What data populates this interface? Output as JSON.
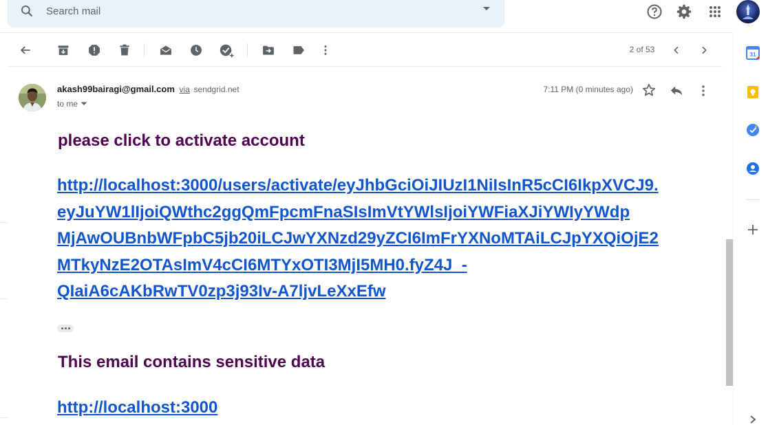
{
  "search": {
    "placeholder": "Search mail"
  },
  "header_icons": [
    "help-icon",
    "settings-icon",
    "apps-grid-icon",
    "account-avatar"
  ],
  "toolbar": {
    "actions": [
      "back",
      "archive",
      "report-spam",
      "delete",
      "mark-unread",
      "snooze",
      "add-to-tasks",
      "move-to",
      "labels",
      "more"
    ],
    "pager": "2 of 53"
  },
  "message": {
    "sender_email": "akash99bairagi@gmail.com",
    "via_label": "via",
    "via_domain": "sendgrid.net",
    "to": "to me",
    "time": "7:11 PM (0 minutes ago)",
    "heading1": "please click to activate account",
    "activation_link_lines": [
      "http://localhost:3000/users/activate/eyJhbGciOiJIUzI1NiIsInR5cCI6IkpXVCJ9.",
      "eyJuYW1lIjoiQWthc2ggQmFpcmFnaSIsImVtYWlsIjoiYWFiaXJiYWIyYWdp",
      "MjAwOUBnbWFpbC5jb20iLCJwYXNzd29yZCI6ImFrYXNoMTAiLCJpYXQiOjE2",
      "MTkyNzE2OTAsImV4cCI6MTYxOTI3MjI5MH0.fyZ4J_-",
      "QIaiA6cAKbRwTV0zp3j93Iv-A7ljvLeXxEfw"
    ],
    "heading2": "This email contains sensitive data",
    "home_link": "http://localhost:3000"
  },
  "colors": {
    "heading": "#500050",
    "link": "#1155cc",
    "search_bg": "#eaf1fb",
    "icon": "#5f6368"
  },
  "side_panel": [
    "calendar-icon",
    "keep-icon",
    "tasks-icon",
    "contacts-icon",
    "add-addon-icon"
  ]
}
